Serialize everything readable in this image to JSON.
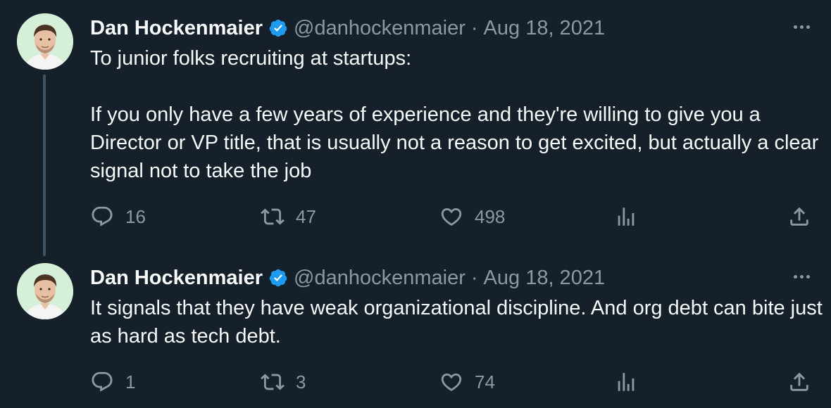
{
  "tweets": [
    {
      "author": {
        "name": "Dan Hockenmaier",
        "handle": "@danhockenmaier",
        "verified": true
      },
      "separator": "·",
      "date": "Aug 18, 2021",
      "paragraphs": [
        "To junior folks recruiting at startups:",
        "If you only have a few years of experience and they're willing to give you a Director or VP title, that is usually not a reason to get excited, but actually a clear signal not to take the job"
      ],
      "stats": {
        "replies": "16",
        "retweets": "47",
        "likes": "498"
      }
    },
    {
      "author": {
        "name": "Dan Hockenmaier",
        "handle": "@danhockenmaier",
        "verified": true
      },
      "separator": "·",
      "date": "Aug 18, 2021",
      "paragraphs": [
        "It signals that they have weak organizational discipline. And org debt can bite just as hard as tech debt."
      ],
      "stats": {
        "replies": "1",
        "retweets": "3",
        "likes": "74"
      }
    }
  ],
  "icons": {
    "verified": "verified-badge-icon",
    "more": "more-horizontal-icon",
    "reply": "reply-icon",
    "retweet": "retweet-icon",
    "like": "heart-icon",
    "views": "views-icon",
    "share": "share-icon"
  },
  "colors": {
    "background": "#15202b",
    "text": "#f7f9f9",
    "secondary_text": "#8b98a5",
    "verified_blue": "#1d9bf0",
    "thread_line": "#3d5466"
  }
}
